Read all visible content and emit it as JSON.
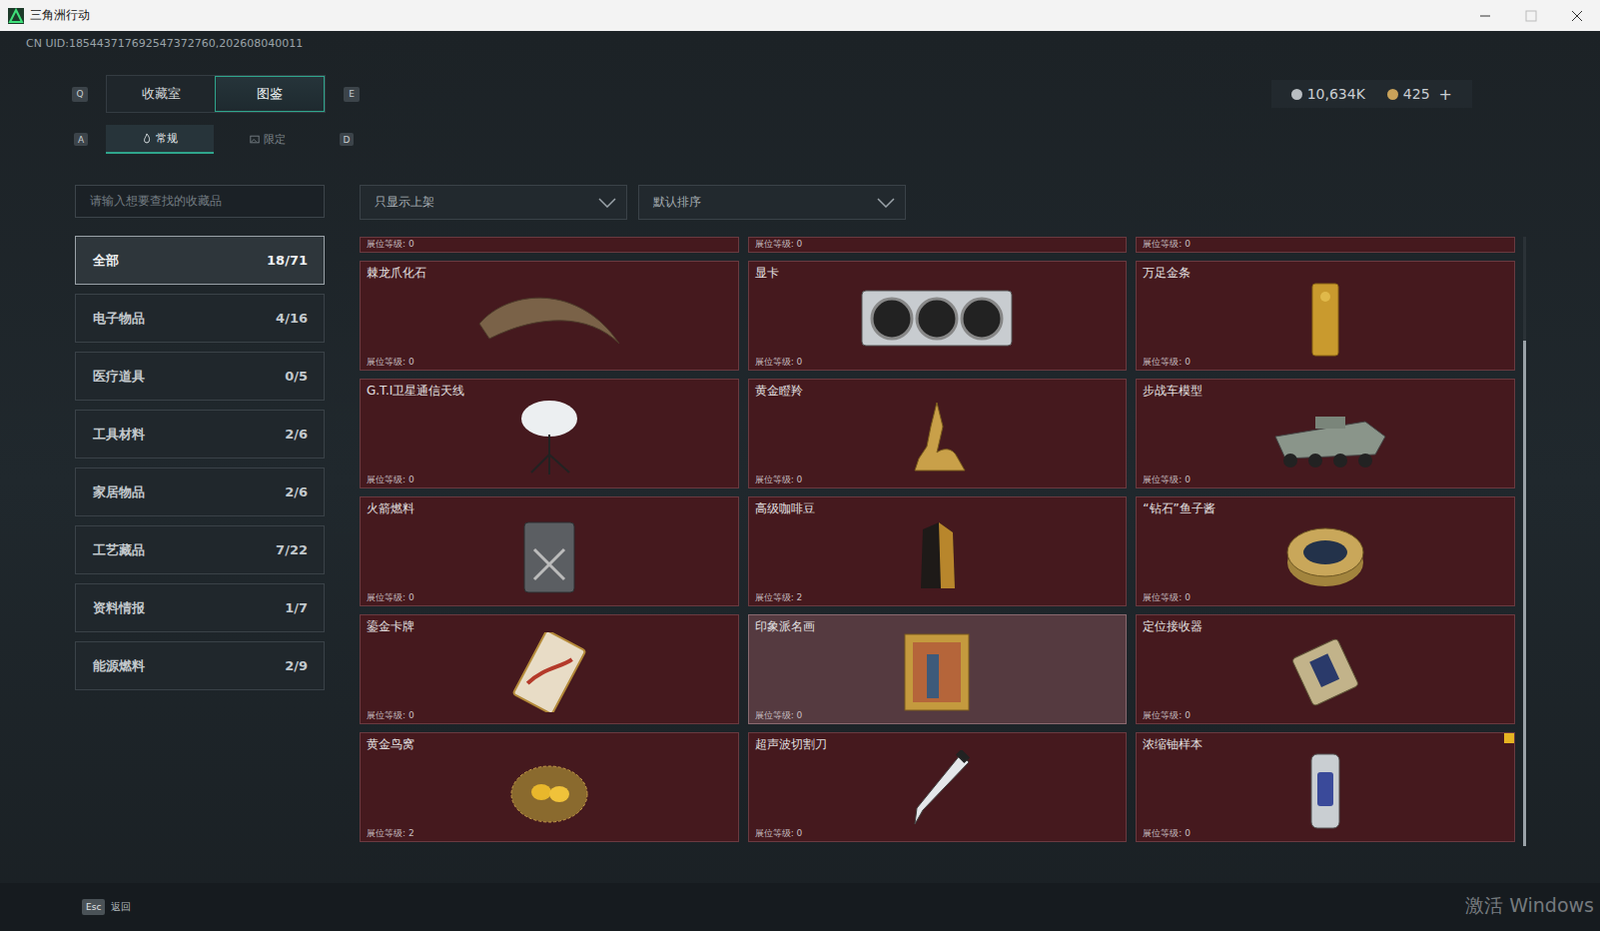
{
  "window": {
    "title": "三角洲行动"
  },
  "uid": "CN UID:185443717692547372760,202608040011",
  "currency": [
    {
      "value": "10,634K",
      "color": "#b9bec2"
    },
    {
      "value": "425",
      "color": "#c9a25a",
      "plus": "+"
    }
  ],
  "tabs": {
    "prev_key": "Q",
    "next_key": "E",
    "items": [
      {
        "label": "收藏室",
        "selected": false
      },
      {
        "label": "图鉴",
        "selected": true
      }
    ]
  },
  "subtabs": {
    "prev_key": "A",
    "next_key": "D",
    "items": [
      {
        "label": "常规",
        "selected": true
      },
      {
        "label": "限定",
        "selected": false
      }
    ]
  },
  "search": {
    "placeholder": "请输入想要查找的收藏品"
  },
  "filters": [
    {
      "label": "只显示上架"
    },
    {
      "label": "默认排序"
    }
  ],
  "sidebar": {
    "items": [
      {
        "label": "全部",
        "count": "18/71",
        "selected": true
      },
      {
        "label": "电子物品",
        "count": "4/16",
        "selected": false
      },
      {
        "label": "医疗道具",
        "count": "0/5",
        "selected": false
      },
      {
        "label": "工具材料",
        "count": "2/6",
        "selected": false
      },
      {
        "label": "家居物品",
        "count": "2/6",
        "selected": false
      },
      {
        "label": "工艺藏品",
        "count": "7/22",
        "selected": false
      },
      {
        "label": "资料情报",
        "count": "1/7",
        "selected": false
      },
      {
        "label": "能源燃料",
        "count": "2/9",
        "selected": false
      }
    ]
  },
  "partial_row": [
    {
      "level": "展位等级: 0"
    },
    {
      "level": "展位等级: 0"
    },
    {
      "level": "展位等级: 0"
    }
  ],
  "cards": [
    {
      "name": "棘龙爪化石",
      "level": "展位等级: 0",
      "highlighted": false,
      "badge": false
    },
    {
      "name": "显卡",
      "level": "展位等级: 0",
      "highlighted": false,
      "badge": false
    },
    {
      "name": "万足金条",
      "level": "展位等级: 0",
      "highlighted": false,
      "badge": false
    },
    {
      "name": "G.T.I卫星通信天线",
      "level": "展位等级: 0",
      "highlighted": false,
      "badge": false
    },
    {
      "name": "黄金瞪羚",
      "level": "展位等级: 0",
      "highlighted": false,
      "badge": false
    },
    {
      "name": "步战车模型",
      "level": "展位等级: 0",
      "highlighted": false,
      "badge": false
    },
    {
      "name": "火箭燃料",
      "level": "展位等级: 0",
      "highlighted": false,
      "badge": false
    },
    {
      "name": "高级咖啡豆",
      "level": "展位等级: 2",
      "highlighted": false,
      "badge": false
    },
    {
      "name": "“钻石”鱼子酱",
      "level": "展位等级: 0",
      "highlighted": false,
      "badge": false
    },
    {
      "name": "鎏金卡牌",
      "level": "展位等级: 0",
      "highlighted": false,
      "badge": false
    },
    {
      "name": "印象派名画",
      "level": "展位等级: 0",
      "highlighted": true,
      "badge": false
    },
    {
      "name": "定位接收器",
      "level": "展位等级: 0",
      "highlighted": false,
      "badge": false
    },
    {
      "name": "黄金鸟窝",
      "level": "展位等级: 2",
      "highlighted": false,
      "badge": false
    },
    {
      "name": "超声波切割刀",
      "level": "展位等级: 0",
      "highlighted": false,
      "badge": false
    },
    {
      "name": "浓缩铀样本",
      "level": "展位等级: 0",
      "highlighted": false,
      "badge": true
    }
  ],
  "scrollbar": {
    "level": 0.83
  },
  "footer": {
    "key": "Esc",
    "label": "返回"
  },
  "watermark": "激活 Windows"
}
